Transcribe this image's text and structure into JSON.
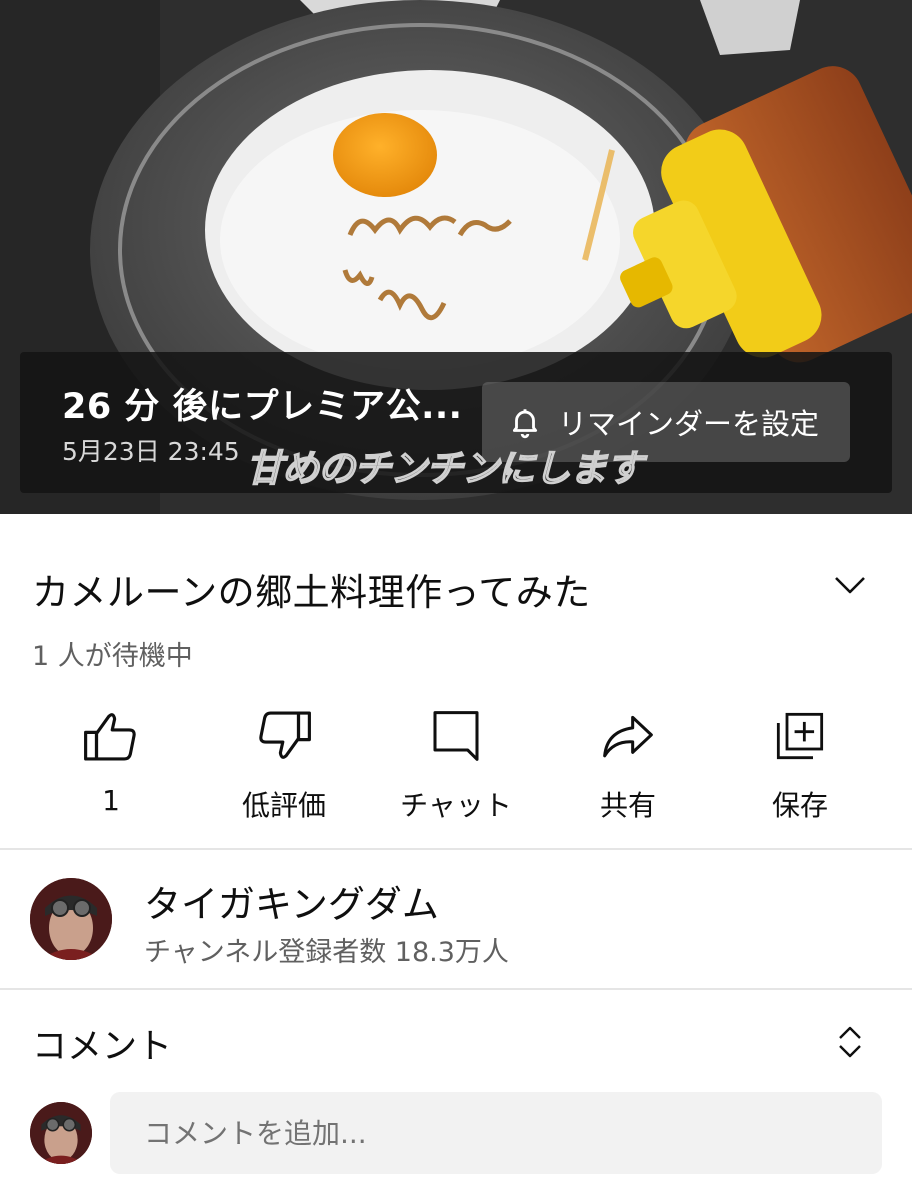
{
  "premiere": {
    "countdown_title": "26 分 後にプレミア公...",
    "scheduled_at": "5月23日 23:45",
    "remind_label": "リマインダーを設定",
    "caption_text": "甘めのチンチンにします"
  },
  "video": {
    "title": "カメルーンの郷土料理作ってみた",
    "waiting": "1 人が待機中"
  },
  "actions": {
    "like_count": "1",
    "dislike_label": "低評価",
    "chat_label": "チャット",
    "share_label": "共有",
    "save_label": "保存"
  },
  "channel": {
    "name": "タイガキングダム",
    "subscribers": "チャンネル登録者数 18.3万人"
  },
  "comments": {
    "header": "コメント",
    "input_placeholder": "コメントを追加..."
  },
  "icons": {
    "bell": "bell-icon",
    "expand": "chevron-down-icon",
    "like": "thumbs-up-icon",
    "dislike": "thumbs-down-icon",
    "chat": "chat-icon",
    "share": "share-icon",
    "save": "save-playlist-icon",
    "sort": "sort-chevrons-icon"
  },
  "colors": {
    "text_primary": "#0f0f0f",
    "text_secondary": "#606060",
    "bottle_cap": "#f2cc18",
    "egg_yolk": "#f29a17"
  }
}
